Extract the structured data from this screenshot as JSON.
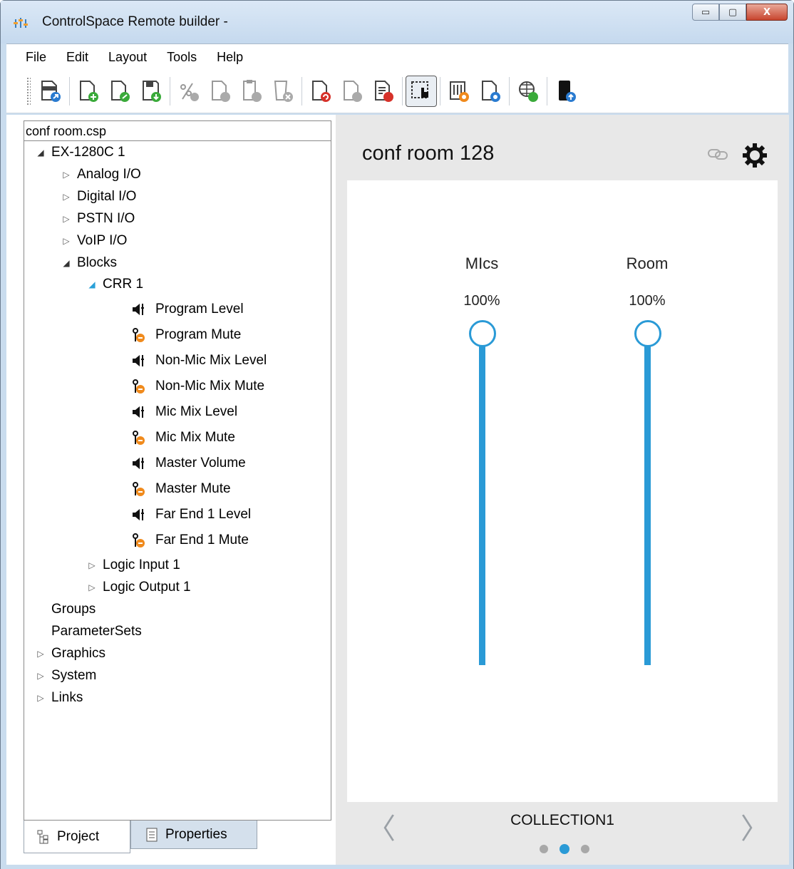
{
  "window": {
    "title": "ControlSpace Remote builder -",
    "minimize_label": "▭",
    "maximize_label": "▢",
    "close_label": "X"
  },
  "menu": [
    "File",
    "Edit",
    "Layout",
    "Tools",
    "Help"
  ],
  "toolbar": {
    "icons": [
      "export-icon",
      "new-page-icon",
      "new-page-from-template-icon",
      "save-page-icon",
      "cut-icon",
      "copy-icon",
      "paste-icon",
      "delete-icon",
      "undo-icon",
      "redo-icon",
      "remove-icon",
      "select-mode-icon",
      "control-settings-icon",
      "page-settings-icon",
      "web-publish-icon",
      "device-upload-icon"
    ],
    "pressed": "select-mode-icon"
  },
  "tree": {
    "header": "conf room.csp",
    "items": [
      {
        "label": "EX-1280C 1",
        "level": 0,
        "state": "open"
      },
      {
        "label": "Analog I/O",
        "level": 1,
        "state": "closed"
      },
      {
        "label": "Digital I/O",
        "level": 1,
        "state": "closed"
      },
      {
        "label": "PSTN I/O",
        "level": 1,
        "state": "closed"
      },
      {
        "label": "VoIP I/O",
        "level": 1,
        "state": "closed"
      },
      {
        "label": "Blocks",
        "level": 1,
        "state": "open"
      },
      {
        "label": "CRR 1",
        "level": 2,
        "state": "open-selected"
      },
      {
        "label": "Program Level",
        "level": 3,
        "icon": "level-icon"
      },
      {
        "label": "Program Mute",
        "level": 3,
        "icon": "mute-icon"
      },
      {
        "label": "Non-Mic Mix Level",
        "level": 3,
        "icon": "level-icon"
      },
      {
        "label": "Non-Mic Mix Mute",
        "level": 3,
        "icon": "mute-icon"
      },
      {
        "label": "Mic Mix Level",
        "level": 3,
        "icon": "level-icon"
      },
      {
        "label": "Mic Mix Mute",
        "level": 3,
        "icon": "mute-icon"
      },
      {
        "label": "Master Volume",
        "level": 3,
        "icon": "level-icon"
      },
      {
        "label": "Master Mute",
        "level": 3,
        "icon": "mute-icon"
      },
      {
        "label": "Far End 1 Level",
        "level": 3,
        "icon": "level-icon"
      },
      {
        "label": "Far End 1 Mute",
        "level": 3,
        "icon": "mute-icon"
      },
      {
        "label": "Logic Input 1",
        "level": 2,
        "state": "closed"
      },
      {
        "label": "Logic Output 1",
        "level": 2,
        "state": "closed"
      },
      {
        "label": "Groups",
        "level": 0,
        "state": "none"
      },
      {
        "label": "ParameterSets",
        "level": 0,
        "state": "none"
      },
      {
        "label": "Graphics",
        "level": 0,
        "state": "closed"
      },
      {
        "label": "System",
        "level": 0,
        "state": "closed"
      },
      {
        "label": "Links",
        "level": 0,
        "state": "closed"
      }
    ]
  },
  "tabs": {
    "project": "Project",
    "properties": "Properties"
  },
  "page": {
    "title": "conf room 128",
    "channels": [
      {
        "label": "MIcs",
        "value_text": "100%",
        "level": 1.0
      },
      {
        "label": "Room",
        "value_text": "100%",
        "level": 1.0
      }
    ],
    "collection": "COLLECTION1",
    "prev_arrow": "〈",
    "next_arrow": "〉",
    "page_count": 3,
    "active_page": 2
  },
  "colors": {
    "accent": "#2a9ad6",
    "mute_badge": "#f08a1c"
  }
}
